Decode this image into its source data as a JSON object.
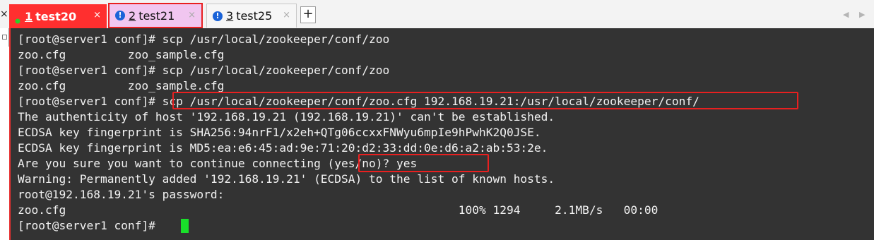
{
  "tabs": [
    {
      "number": "1",
      "name": "test20",
      "close": "×",
      "state": "active",
      "status_icon": "green-dot-icon"
    },
    {
      "number": "2",
      "name": "test21",
      "close": "×",
      "state": "highlighted",
      "status_icon": "info-icon"
    },
    {
      "number": "3",
      "name": "test25",
      "close": "×",
      "state": "normal",
      "status_icon": "info-icon"
    }
  ],
  "tabbar": {
    "left_close": "×",
    "add_tab": "+",
    "prev_arrow": "◀",
    "next_arrow": "▶"
  },
  "colors": {
    "active_tab": "#ff2f2f",
    "highlight_tab": "#f1c6f0",
    "highlight_border": "#e82020",
    "terminal_bg": "#333333",
    "terminal_text": "#f2f2f2",
    "cursor": "#19e02a"
  },
  "terminal": {
    "lines": [
      "[root@server1 conf]# scp /usr/local/zookeeper/conf/zoo",
      "zoo.cfg         zoo_sample.cfg",
      "[root@server1 conf]# scp /usr/local/zookeeper/conf/zoo",
      "zoo.cfg         zoo_sample.cfg",
      "[root@server1 conf]# scp /usr/local/zookeeper/conf/zoo.cfg 192.168.19.21:/usr/local/zookeeper/conf/",
      "The authenticity of host '192.168.19.21 (192.168.19.21)' can't be established.",
      "ECDSA key fingerprint is SHA256:94nrF1/x2eh+QTg06ccxxFNWyu6mpIe9hPwhK2Q0JSE.",
      "ECDSA key fingerprint is MD5:ea:e6:45:ad:9e:71:20:d2:33:dd:0e:d6:a2:ab:53:2e.",
      "Are you sure you want to continue connecting (yes/no)? yes",
      "Warning: Permanently added '192.168.19.21' (ECDSA) to the list of known hosts.",
      "root@192.168.19.21's password:",
      "zoo.cfg                                                         100% 1294     2.1MB/s   00:00",
      "[root@server1 conf]# "
    ]
  }
}
